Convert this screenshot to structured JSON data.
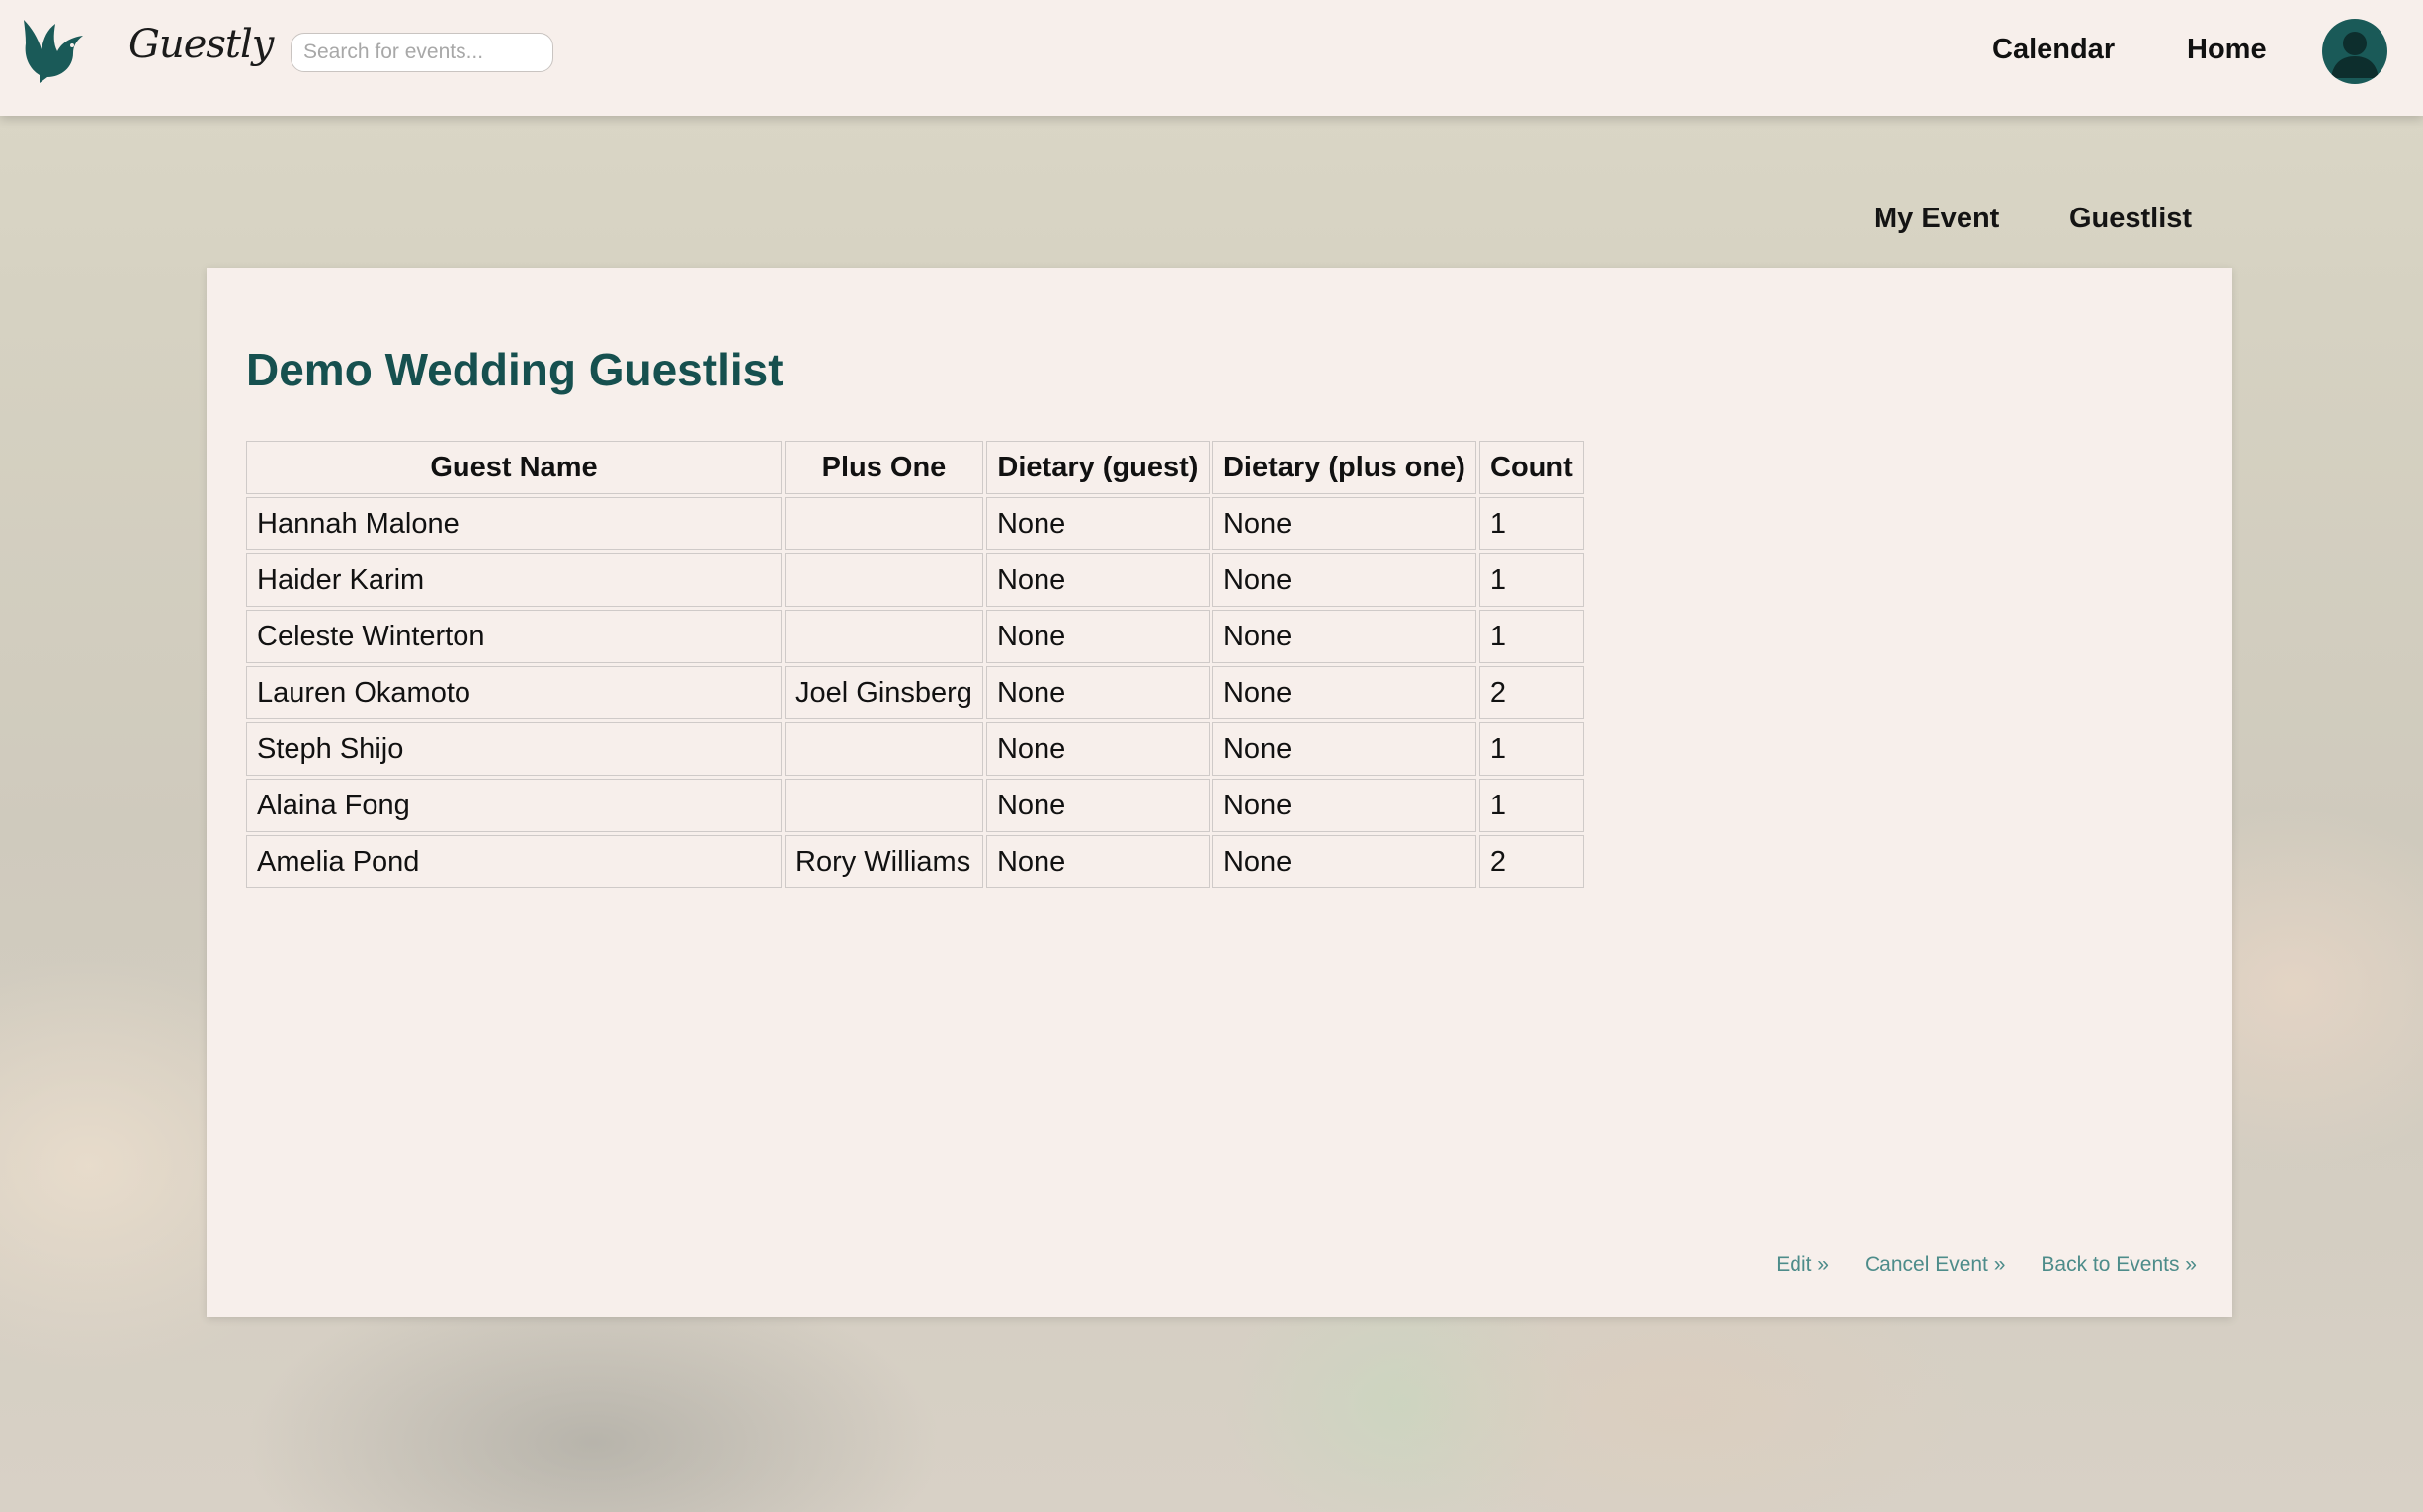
{
  "header": {
    "brand": "Guestly",
    "search_placeholder": "Search for events...",
    "nav": [
      {
        "label": "Calendar"
      },
      {
        "label": "Home"
      }
    ],
    "colors": {
      "bar": "#f7efeb",
      "accent": "#16504f"
    }
  },
  "subnav": [
    {
      "label": "My Event"
    },
    {
      "label": "Guestlist"
    }
  ],
  "main": {
    "title": "Demo Wedding Guestlist",
    "table": {
      "headers": [
        "Guest Name",
        "Plus One",
        "Dietary (guest)",
        "Dietary (plus one)",
        "Count"
      ],
      "rows": [
        [
          "Hannah Malone",
          "",
          "None",
          "None",
          "1"
        ],
        [
          "Haider Karim",
          "",
          "None",
          "None",
          "1"
        ],
        [
          "Celeste Winterton",
          "",
          "None",
          "None",
          "1"
        ],
        [
          "Lauren Okamoto",
          "Joel Ginsberg",
          "None",
          "None",
          "2"
        ],
        [
          "Steph Shijo",
          "",
          "None",
          "None",
          "1"
        ],
        [
          "Alaina Fong",
          "",
          "None",
          "None",
          "1"
        ],
        [
          "Amelia Pond",
          "Rory Williams",
          "None",
          "None",
          "2"
        ]
      ]
    },
    "footer_links": [
      {
        "label": "Edit »"
      },
      {
        "label": "Cancel Event »"
      },
      {
        "label": "Back to Events »"
      }
    ]
  }
}
